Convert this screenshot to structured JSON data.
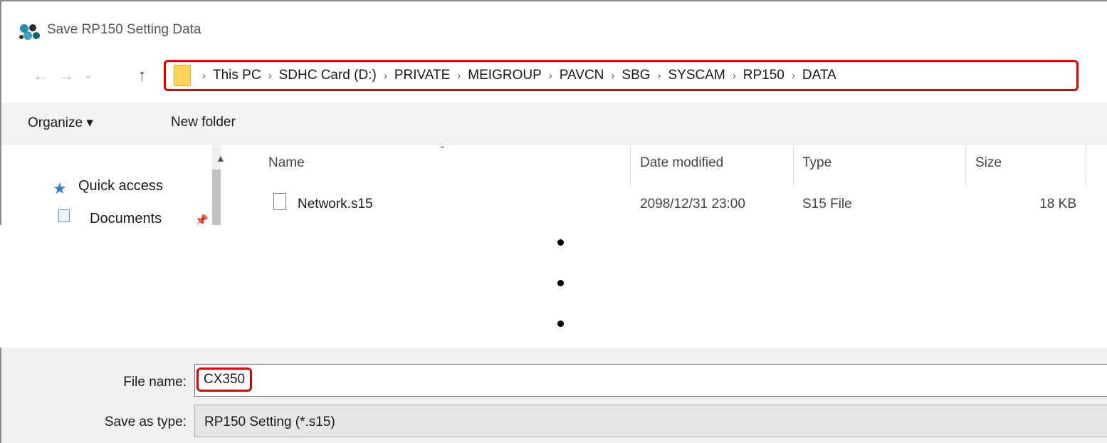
{
  "window": {
    "title": "Save RP150 Setting Data"
  },
  "nav": {
    "back_glyph": "←",
    "forward_glyph": "→",
    "recent_glyph": "⌄",
    "up_glyph": "↑"
  },
  "breadcrumb": [
    "This PC",
    "SDHC Card (D:)",
    "PRIVATE",
    "MEIGROUP",
    "PAVCN",
    "SBG",
    "SYSCAM",
    "RP150",
    "DATA"
  ],
  "toolbar": {
    "organize_label": "Organize ▾",
    "new_folder_label": "New folder"
  },
  "sidebar": {
    "items": [
      {
        "label": "Quick access",
        "icon": "star-icon"
      },
      {
        "label": "Documents",
        "icon": "documents-icon",
        "pinned": true
      }
    ]
  },
  "file_list": {
    "columns": [
      "Name",
      "Date modified",
      "Type",
      "Size"
    ],
    "rows": [
      {
        "name": "Network.s15",
        "date": "2098/12/31 23:00",
        "type": "S15 File",
        "size": "18 KB"
      }
    ]
  },
  "save_form": {
    "file_name_label": "File name:",
    "file_name_value": "CX350",
    "save_type_label": "Save as type:",
    "save_type_value": "RP150 Setting (*.s15)"
  },
  "colors": {
    "highlight": "#e00000",
    "folder": "#ffd25a",
    "quick_access": "#2e7fd6"
  }
}
